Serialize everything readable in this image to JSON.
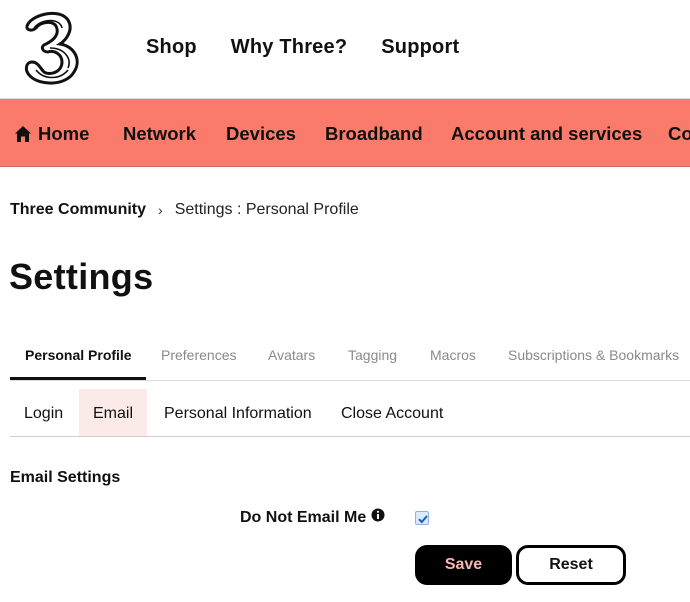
{
  "header": {
    "logo": "three-logo",
    "nav": [
      "Shop",
      "Why Three?",
      "Support"
    ]
  },
  "main_nav": {
    "home": "Home",
    "items": [
      "Network",
      "Devices",
      "Broadband",
      "Account and services",
      "Co"
    ]
  },
  "breadcrumb": {
    "root": "Three Community",
    "separator": "›",
    "current": "Settings : Personal Profile"
  },
  "page": {
    "title": "Settings"
  },
  "tabs": [
    "Personal Profile",
    "Preferences",
    "Avatars",
    "Tagging",
    "Macros",
    "Subscriptions & Bookmarks"
  ],
  "subtabs": [
    "Login",
    "Email",
    "Personal Information",
    "Close Account"
  ],
  "email_settings": {
    "heading": "Email Settings",
    "do_not_email_label": "Do Not Email Me",
    "do_not_email_checked": true
  },
  "buttons": {
    "save": "Save",
    "reset": "Reset"
  },
  "colors": {
    "nav_bg": "#fa7b6b",
    "active_subtab_bg": "#fbeae8",
    "save_text": "#f6b7ae"
  }
}
